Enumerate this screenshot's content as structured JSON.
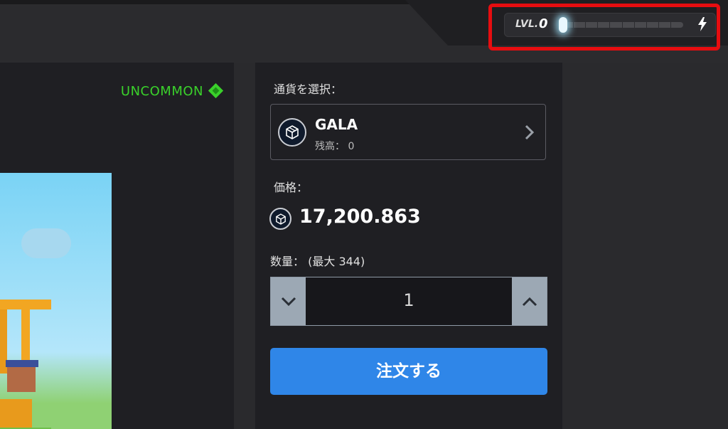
{
  "header": {
    "level_label": "LVL.",
    "level_value": "0",
    "xp_progress": 0.02,
    "icons": [
      "bolt-icon"
    ]
  },
  "item": {
    "rarity": "UNCOMMON",
    "rarity_color": "#3ad12b",
    "rarity_icon": "diamond-gem-icon"
  },
  "order": {
    "currency_label": "通貨を選択：",
    "currency": {
      "name": "GALA",
      "balance": "残高： 0",
      "icon": "gala-coin-icon"
    },
    "price_label": "価格：",
    "price": "17,200.863",
    "quantity_label": "数量：",
    "quantity_max": "(最大 344)",
    "quantity_value": "1",
    "buy_button": "注文する",
    "accent_color": "#2f86e8"
  }
}
